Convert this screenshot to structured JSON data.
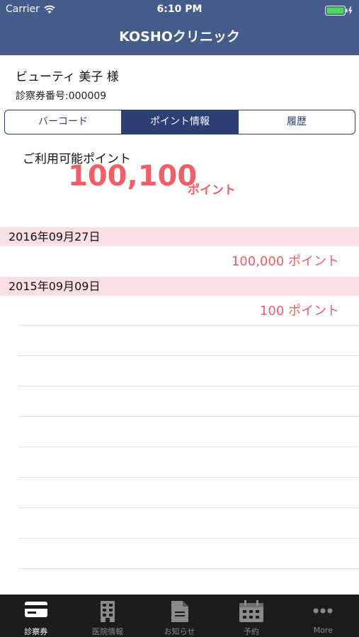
{
  "status": {
    "carrier": "Carrier",
    "time": "6:10 PM"
  },
  "header": {
    "title": "KOSHOクリニック"
  },
  "user": {
    "name": "ビューティ 美子 様",
    "card_number": "診察券番号:000009"
  },
  "tabs": [
    {
      "label": "バーコード",
      "active": false
    },
    {
      "label": "ポイント情報",
      "active": true
    },
    {
      "label": "履歴",
      "active": false
    }
  ],
  "points": {
    "label": "ご利用可能ポイント",
    "value": "100,100",
    "unit": "ポイント"
  },
  "history": [
    {
      "date": "2016年09月27日",
      "points": "100,000 ポイント"
    },
    {
      "date": "2015年09月09日",
      "points": "100 ポイント"
    }
  ],
  "tabbar": [
    {
      "label": "診察券",
      "icon": "card-icon",
      "active": true
    },
    {
      "label": "医院情報",
      "icon": "building-icon",
      "active": false
    },
    {
      "label": "お知らせ",
      "icon": "document-icon",
      "active": false
    },
    {
      "label": "予約",
      "icon": "calendar-icon",
      "active": false
    },
    {
      "label": "More",
      "icon": "more-icon",
      "active": false
    }
  ],
  "colors": {
    "nav": "#455b8a",
    "accent": "#ef5f68",
    "segment": "#2c3e72",
    "date_row": "#f7dfe3"
  }
}
